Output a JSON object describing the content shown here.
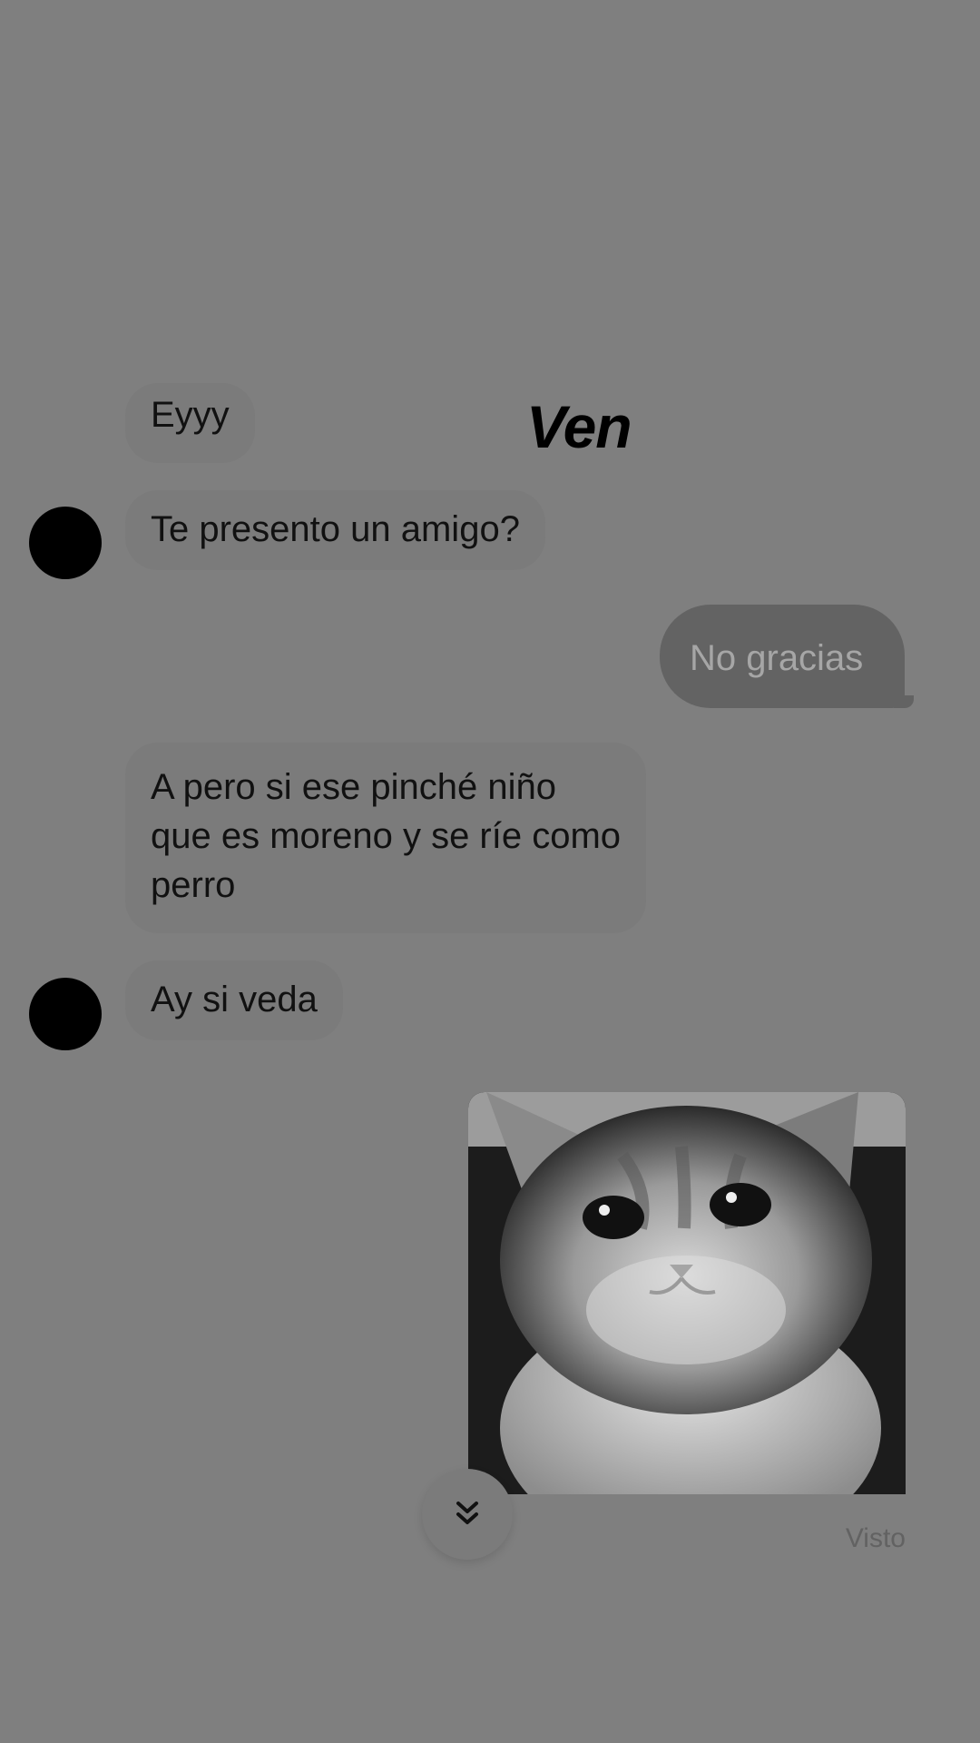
{
  "overlay_text": "Ven",
  "messages": [
    {
      "from": "them",
      "text": "Eyyy"
    },
    {
      "from": "them",
      "text": "Te presento un amigo?"
    },
    {
      "from": "me",
      "text": "No gracias"
    },
    {
      "from": "them",
      "lines": [
        "A pero si ese pinché niño",
        "que es moreno y se ríe como",
        "perro"
      ]
    },
    {
      "from": "them",
      "text": "Ay si veda"
    },
    {
      "from": "me",
      "type": "image",
      "description_icon": "crying-cat-image"
    }
  ],
  "status": "Visto",
  "scroll_button_icon": "double-chevron-down-icon",
  "colors": {
    "background": "#7f7f7f",
    "incoming_bubble": "#7b7b7b",
    "outgoing_bubble": "#636363",
    "avatar": "#000000"
  }
}
